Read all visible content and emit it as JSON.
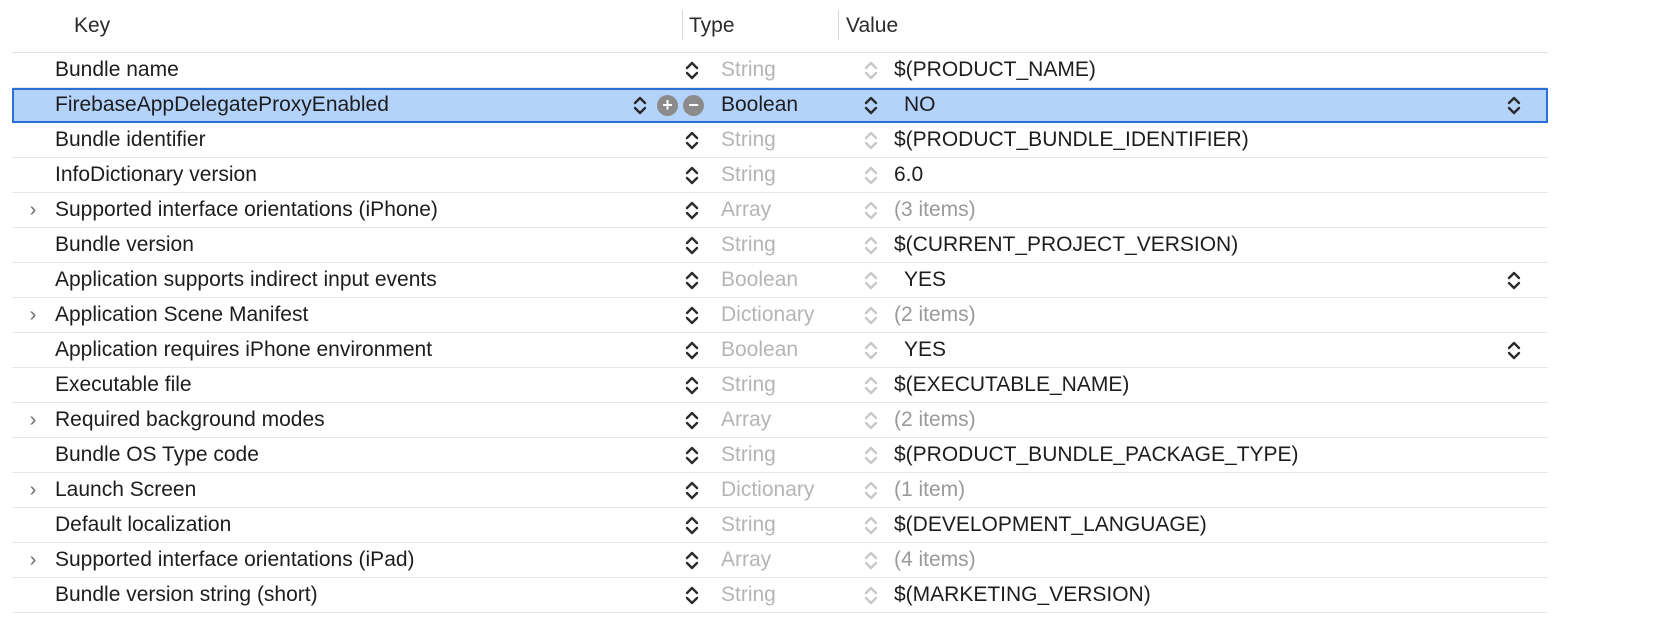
{
  "header": {
    "key_label": "Key",
    "type_label": "Type",
    "value_label": "Value"
  },
  "rows": [
    {
      "key": "Bundle name",
      "type": "String",
      "value": "$(PRODUCT_NAME)",
      "expandable": false,
      "muted": false,
      "bool": false
    },
    {
      "key": "FirebaseAppDelegateProxyEnabled",
      "type": "Boolean",
      "value": "NO",
      "expandable": false,
      "muted": false,
      "bool": true,
      "selected": true
    },
    {
      "key": "Bundle identifier",
      "type": "String",
      "value": "$(PRODUCT_BUNDLE_IDENTIFIER)",
      "expandable": false,
      "muted": false,
      "bool": false
    },
    {
      "key": "InfoDictionary version",
      "type": "String",
      "value": "6.0",
      "expandable": false,
      "muted": false,
      "bool": false
    },
    {
      "key": "Supported interface orientations (iPhone)",
      "type": "Array",
      "value": "(3 items)",
      "expandable": true,
      "muted": true,
      "bool": false
    },
    {
      "key": "Bundle version",
      "type": "String",
      "value": "$(CURRENT_PROJECT_VERSION)",
      "expandable": false,
      "muted": false,
      "bool": false
    },
    {
      "key": "Application supports indirect input events",
      "type": "Boolean",
      "value": "YES",
      "expandable": false,
      "muted": false,
      "bool": true
    },
    {
      "key": "Application Scene Manifest",
      "type": "Dictionary",
      "value": "(2 items)",
      "expandable": true,
      "muted": true,
      "bool": false
    },
    {
      "key": "Application requires iPhone environment",
      "type": "Boolean",
      "value": "YES",
      "expandable": false,
      "muted": false,
      "bool": true
    },
    {
      "key": "Executable file",
      "type": "String",
      "value": "$(EXECUTABLE_NAME)",
      "expandable": false,
      "muted": false,
      "bool": false
    },
    {
      "key": "Required background modes",
      "type": "Array",
      "value": "(2 items)",
      "expandable": true,
      "muted": true,
      "bool": false
    },
    {
      "key": "Bundle OS Type code",
      "type": "String",
      "value": "$(PRODUCT_BUNDLE_PACKAGE_TYPE)",
      "expandable": false,
      "muted": false,
      "bool": false
    },
    {
      "key": "Launch Screen",
      "type": "Dictionary",
      "value": "(1 item)",
      "expandable": true,
      "muted": true,
      "bool": false
    },
    {
      "key": "Default localization",
      "type": "String",
      "value": "$(DEVELOPMENT_LANGUAGE)",
      "expandable": false,
      "muted": false,
      "bool": false
    },
    {
      "key": "Supported interface orientations (iPad)",
      "type": "Array",
      "value": "(4 items)",
      "expandable": true,
      "muted": true,
      "bool": false
    },
    {
      "key": "Bundle version string (short)",
      "type": "String",
      "value": "$(MARKETING_VERSION)",
      "expandable": false,
      "muted": false,
      "bool": false
    }
  ],
  "icons": {
    "disclosure": "chevron-right-icon",
    "stepper": "up-down-chevron-icon",
    "add": "plus-circle-icon",
    "remove": "minus-circle-icon"
  },
  "colors": {
    "selection_fill": "#b4d3fb",
    "selection_border": "#2a6fd6",
    "muted_text": "#b5b5b5"
  }
}
